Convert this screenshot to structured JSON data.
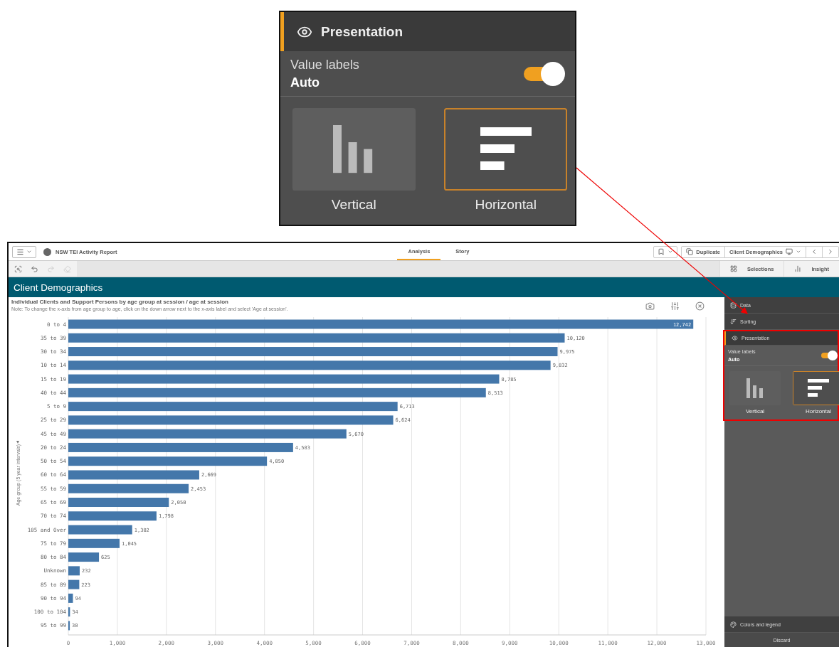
{
  "callout": {
    "section": {
      "label": "Presentation",
      "expanded": true
    },
    "value_labels": {
      "label": "Value labels",
      "value": "Auto",
      "on": true
    },
    "orientations": [
      {
        "kind": "vertical",
        "label": "Vertical",
        "selected": false
      },
      {
        "kind": "horizontal",
        "label": "Horizontal",
        "selected": true
      }
    ]
  },
  "app": {
    "title": "NSW TEI Activity Report",
    "tabs": [
      {
        "label": "Analysis",
        "selected": true
      },
      {
        "label": "Story",
        "selected": false
      }
    ],
    "duplicate": "Duplicate",
    "sheet": "Client Demographics",
    "tools": [
      {
        "kind": "search",
        "disabled": false
      },
      {
        "kind": "back",
        "disabled": false
      },
      {
        "kind": "forward",
        "disabled": true
      },
      {
        "kind": "clear",
        "disabled": true
      }
    ],
    "toolbar_right": [
      {
        "kind": "selections",
        "label": "Selections"
      },
      {
        "kind": "insights",
        "label": "Insight"
      }
    ],
    "sheet_title": "Client Demographics",
    "chart": {
      "title": "Individual Clients and Support Persons by age group at session / age at session",
      "note": "Note: To change the x-axis from age group to age, click on the down arrow next to the x-axis label and select 'Age at session'.",
      "chart_data": {
        "type": "bar",
        "orientation": "horizontal",
        "ylabel": "Age group (5 year intervals)",
        "grid": true,
        "value_labels": [
          "12,742",
          "10,120",
          "9,975",
          "9,832",
          "8,785",
          "8,513",
          "6,713",
          "6,624",
          "5,670",
          "4,583",
          "4,050",
          "2,669",
          "2,453",
          "2,050",
          "1,798",
          "1,302",
          "1,045",
          "625",
          "232",
          "223",
          "94",
          "34",
          "30"
        ],
        "categories": [
          "0 to 4",
          "35 to 39",
          "30 to 34",
          "10 to 14",
          "15 to 19",
          "40 to 44",
          "5 to 9",
          "25 to 29",
          "45 to 49",
          "20 to 24",
          "50 to 54",
          "60 to 64",
          "55 to 59",
          "65 to 69",
          "70 to 74",
          "105 and Over",
          "75 to 79",
          "80 to 84",
          "Unknown",
          "85 to 89",
          "90 to 94",
          "100 to 104",
          "95 to 99"
        ],
        "series": [
          {
            "color": "#4477aa",
            "values": [
              12742,
              10120,
              9975,
              9832,
              8785,
              8513,
              6713,
              6624,
              5670,
              4583,
              4050,
              2669,
              2453,
              2050,
              1798,
              1302,
              1045,
              625,
              232,
              223,
              94,
              34,
              30
            ]
          }
        ],
        "xlim": [
          0,
          13000
        ],
        "xticks": [
          0,
          {
            "value": 1000,
            "label": "1,000"
          },
          {
            "value": 2000,
            "label": "2,000"
          },
          {
            "value": 3000,
            "label": "3,000"
          },
          {
            "value": 4000,
            "label": "4,000"
          },
          {
            "value": 5000,
            "label": "5,000"
          },
          {
            "value": 6000,
            "label": "6,000"
          },
          {
            "value": 7000,
            "label": "7,000"
          },
          {
            "value": 8000,
            "label": "8,000"
          },
          {
            "value": 9000,
            "label": "9,000"
          },
          {
            "value": 10000,
            "label": "10,000"
          },
          {
            "value": 11000,
            "label": "11,000"
          },
          {
            "value": 12000,
            "label": "12,000"
          },
          {
            "value": 13000,
            "label": "13,000"
          }
        ]
      }
    },
    "panel": {
      "sections": [
        {
          "kind": "data",
          "label": "Data",
          "expanded": false
        },
        {
          "kind": "sorting",
          "label": "Sorting",
          "expanded": false
        },
        {
          "kind": "presentation",
          "label": "Presentation",
          "expanded": true
        }
      ],
      "value_labels": {
        "label": "Value labels",
        "value": "Auto",
        "on": true
      },
      "orientations": [
        {
          "kind": "vertical",
          "label": "Vertical",
          "selected": false
        },
        {
          "kind": "horizontal",
          "label": "Horizontal",
          "selected": true
        }
      ],
      "bottom_section": {
        "kind": "colors",
        "label": "Colors and legend"
      },
      "discard": "Discard"
    }
  }
}
